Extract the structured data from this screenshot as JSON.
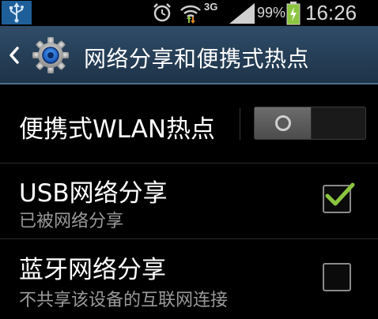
{
  "status_bar": {
    "network_type": "3G",
    "battery_percent": "99%",
    "time": "16:26",
    "icons": [
      "usb-icon",
      "alarm-icon",
      "wifi-hotspot-icon",
      "signal-icon",
      "battery-charging-icon"
    ]
  },
  "action_bar": {
    "title": "网络分享和便携式热点",
    "icons": [
      "back-chevron-icon",
      "settings-gear-icon"
    ]
  },
  "settings": [
    {
      "title": "便携式WLAN热点",
      "control": "toggle",
      "state": "off"
    },
    {
      "title": "USB网络分享",
      "summary": "已被网络分享",
      "control": "checkbox",
      "checked": true
    },
    {
      "title": "蓝牙网络分享",
      "summary": "不共享该设备的互联网连接",
      "control": "checkbox",
      "checked": false
    }
  ],
  "colors": {
    "action_bar": "#2f4c68",
    "check_green": "#8bc53f",
    "usb_badge": "#1f5f99",
    "battery_green": "#8bc53f"
  }
}
